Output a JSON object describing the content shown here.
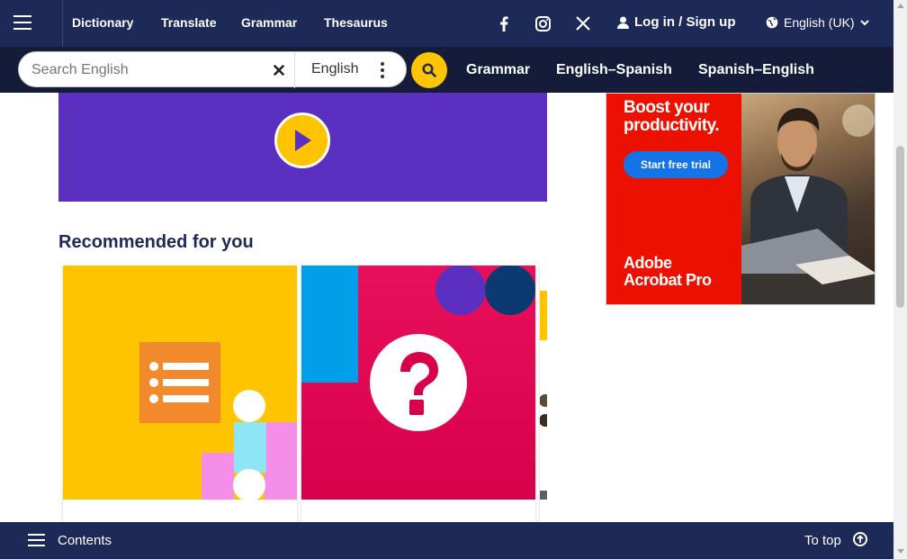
{
  "topnav": {
    "links": [
      "Dictionary",
      "Translate",
      "Grammar",
      "Thesaurus"
    ],
    "social_icons": [
      "facebook-icon",
      "instagram-icon",
      "x-icon"
    ],
    "login_label": "Log in / Sign up",
    "language_label": "English (UK)"
  },
  "search": {
    "placeholder": "Search English",
    "dictionary_select": "English",
    "sub_links": [
      "Grammar",
      "English–Spanish",
      "Spanish–English"
    ]
  },
  "main": {
    "recommended_title": "Recommended for you",
    "cards": [
      {
        "image_icon": "list-icon",
        "caption": ""
      },
      {
        "image_icon": "question-mark-icon",
        "caption": ""
      }
    ]
  },
  "ad": {
    "headline": "Boost your productivity.",
    "cta": "Start free trial",
    "brand_line1": "Adobe",
    "brand_line2": "Acrobat Pro"
  },
  "bottombar": {
    "contents_label": "Contents",
    "totop_label": "To top"
  },
  "colors": {
    "navy": "#1d2a57",
    "search_navy": "#141c3a",
    "yellow": "#fec400",
    "purple": "#5b2fc0",
    "adobe_red": "#eb1000",
    "magenta": "#e0004d"
  }
}
